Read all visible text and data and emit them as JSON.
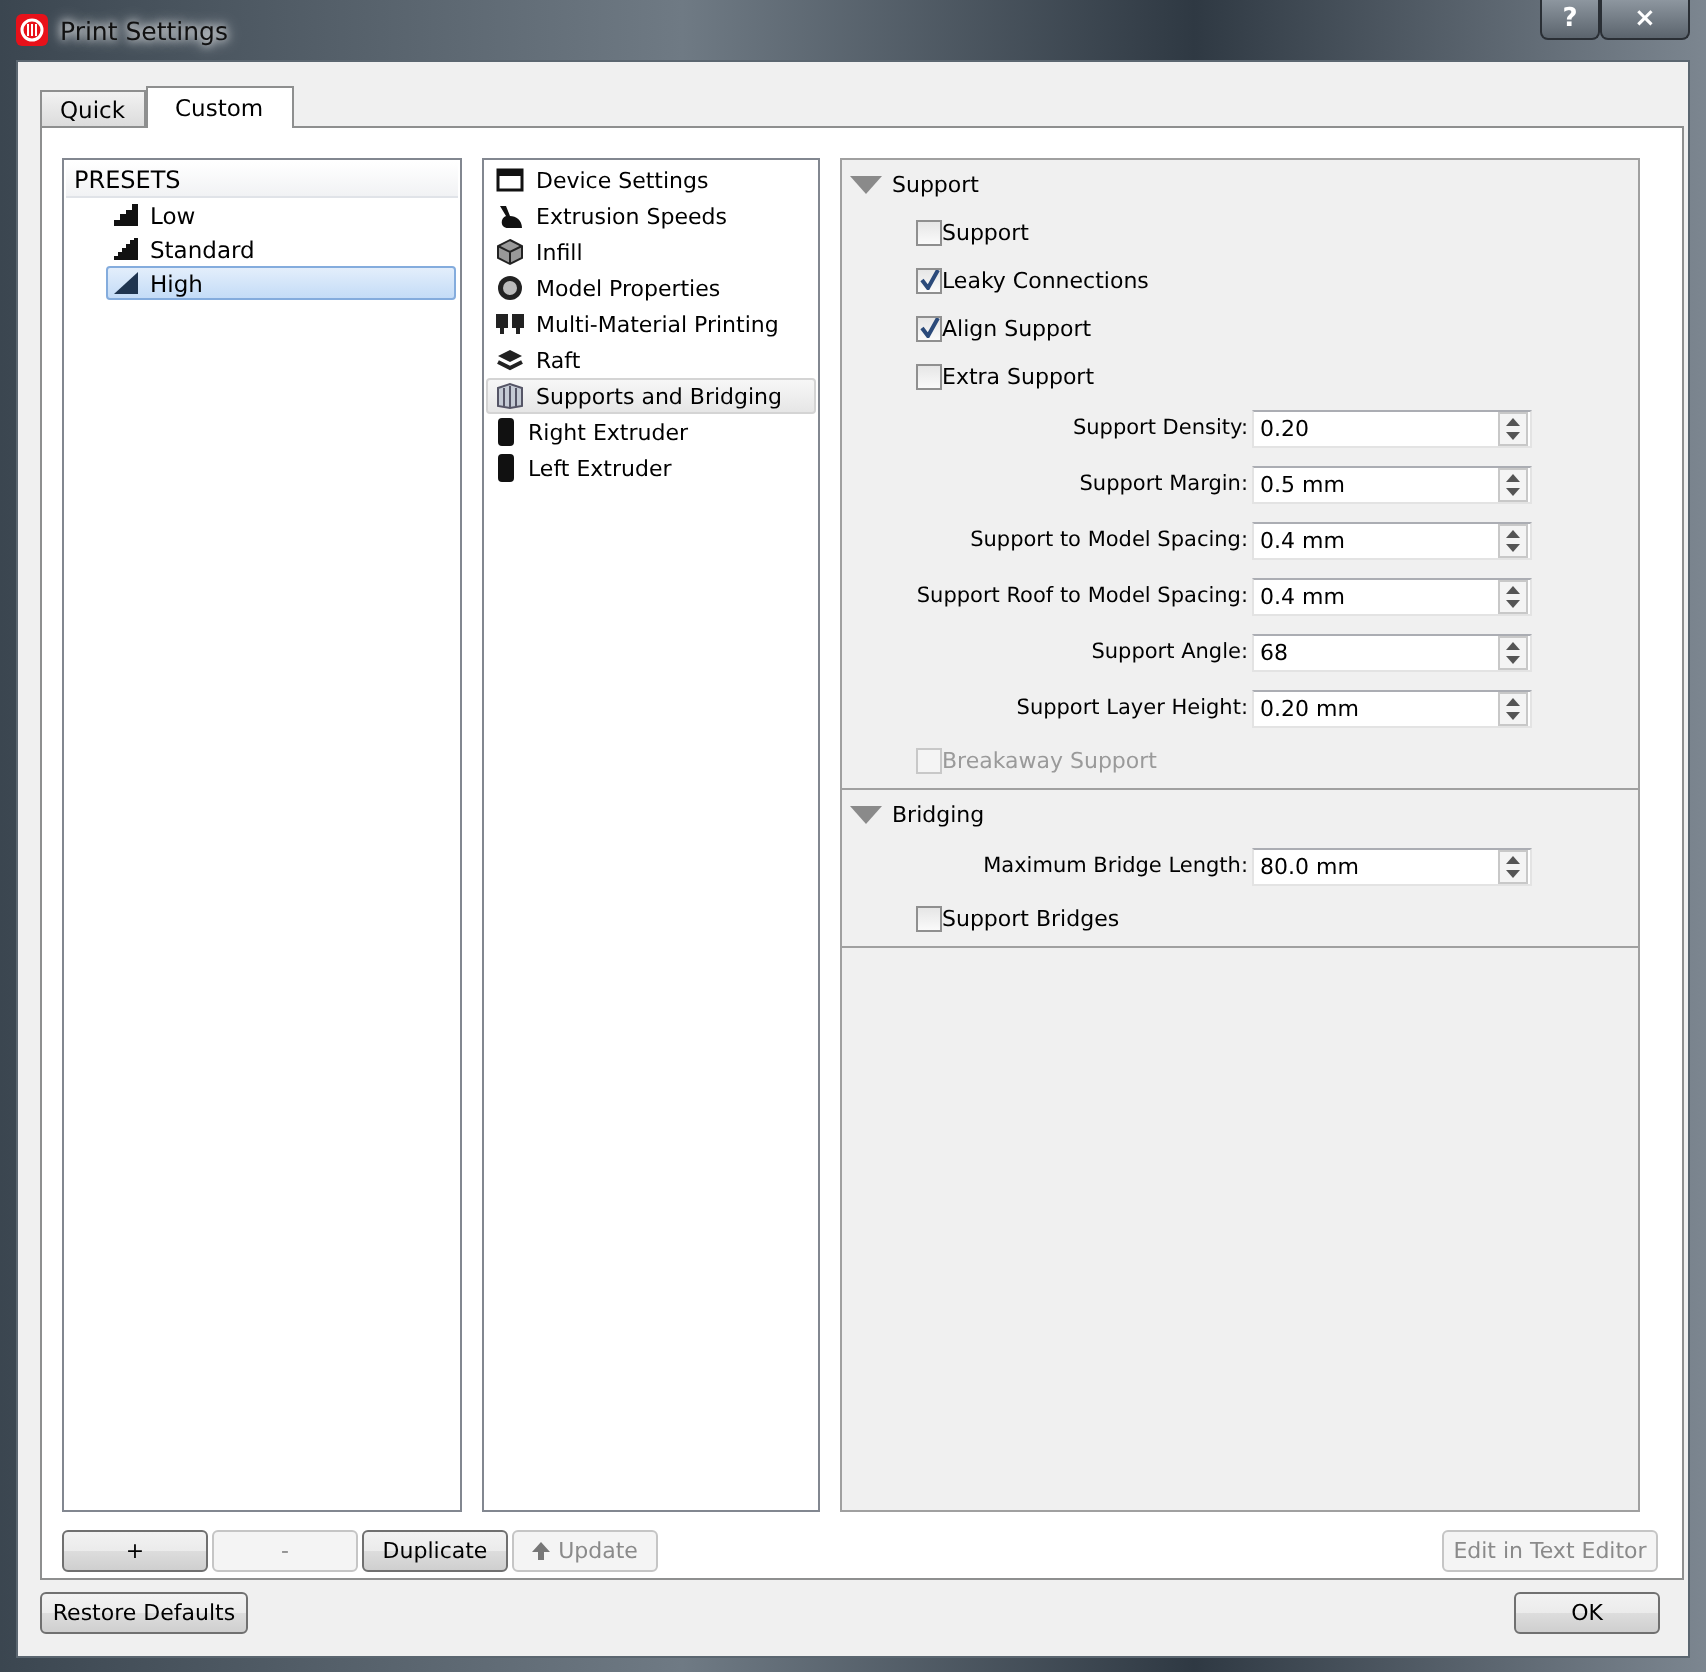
{
  "window": {
    "title": "Print Settings",
    "controls": [
      "?",
      "×"
    ]
  },
  "tabs": [
    {
      "label": "Quick",
      "selected": false
    },
    {
      "label": "Custom",
      "selected": true
    }
  ],
  "presets": {
    "header": "PRESETS",
    "items": [
      {
        "label": "Low",
        "selected": false
      },
      {
        "label": "Standard",
        "selected": false
      },
      {
        "label": "High",
        "selected": true
      }
    ]
  },
  "categories": [
    {
      "label": "Device Settings",
      "selected": false
    },
    {
      "label": "Extrusion Speeds",
      "selected": false
    },
    {
      "label": "Infill",
      "selected": false
    },
    {
      "label": "Model Properties",
      "selected": false
    },
    {
      "label": "Multi-Material Printing",
      "selected": false
    },
    {
      "label": "Raft",
      "selected": false
    },
    {
      "label": "Supports and Bridging",
      "selected": true
    },
    {
      "label": "Right Extruder",
      "selected": false
    },
    {
      "label": "Left Extruder",
      "selected": false
    }
  ],
  "sections": [
    {
      "title": "Support",
      "expanded": true,
      "items": [
        {
          "kind": "checkbox",
          "label": "Support",
          "checked": false,
          "disabled": false
        },
        {
          "kind": "checkbox",
          "label": "Leaky Connections",
          "checked": true,
          "disabled": false
        },
        {
          "kind": "checkbox",
          "label": "Align Support",
          "checked": true,
          "disabled": false
        },
        {
          "kind": "checkbox",
          "label": "Extra Support",
          "checked": false,
          "disabled": false
        },
        {
          "kind": "spin",
          "label": "Support Density:",
          "value": "0.20"
        },
        {
          "kind": "spin",
          "label": "Support Margin:",
          "value": "0.5 mm"
        },
        {
          "kind": "spin",
          "label": "Support to Model Spacing:",
          "value": "0.4 mm"
        },
        {
          "kind": "spin",
          "label": "Support Roof to Model Spacing:",
          "value": "0.4 mm"
        },
        {
          "kind": "spin",
          "label": "Support Angle:",
          "value": "68"
        },
        {
          "kind": "spin",
          "label": "Support Layer Height:",
          "value": "0.20 mm"
        },
        {
          "kind": "checkbox",
          "label": "Breakaway Support",
          "checked": false,
          "disabled": true
        }
      ]
    },
    {
      "title": "Bridging",
      "expanded": true,
      "items": [
        {
          "kind": "spin",
          "label": "Maximum Bridge Length:",
          "value": "80.0 mm"
        },
        {
          "kind": "checkbox",
          "label": "Support Bridges",
          "checked": false,
          "disabled": false
        }
      ]
    }
  ],
  "preset_buttons": [
    {
      "label": "+",
      "disabled": false
    },
    {
      "label": "-",
      "disabled": true
    },
    {
      "label": "Duplicate",
      "disabled": false
    },
    {
      "label": "Update",
      "disabled": true
    }
  ],
  "editor_button": {
    "label": "Edit in Text Editor",
    "disabled": true
  },
  "footer": {
    "restore": "Restore Defaults",
    "ok": "OK"
  }
}
